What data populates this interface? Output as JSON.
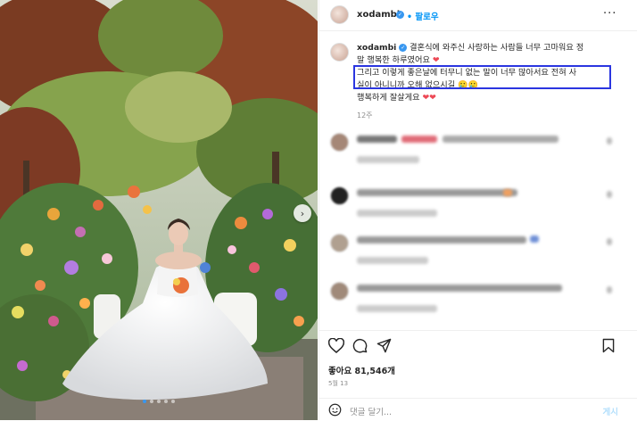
{
  "post": {
    "username": "xodambi",
    "follow_label": "팔로우",
    "more_label": "···",
    "caption_line1": "결혼식에 와주신 사랑하는 사람들 너무 고마워요 정",
    "caption_line2": "말 행복한 하루였어요",
    "highlight_line1": "그리고 이렇게 좋은날에 터무니 없는 말이 너무 많아서요 전혀 사",
    "highlight_line2": "실이 아니니까 오해 없으시길",
    "caption_line4": "행복하게 잘살게요",
    "caption_time": "12주",
    "likes": "좋아요 81,546개",
    "date": "5월 13",
    "comment_placeholder": "댓글 달기...",
    "post_label": "게시"
  },
  "colors": {
    "accent": "#0095f6",
    "highlight_box": "#2b36e0",
    "heart": "#ed4956"
  },
  "icons": [
    "heart-icon",
    "comment-icon",
    "share-icon",
    "bookmark-icon",
    "emoji-icon",
    "verified-icon",
    "chevron-right-icon"
  ]
}
